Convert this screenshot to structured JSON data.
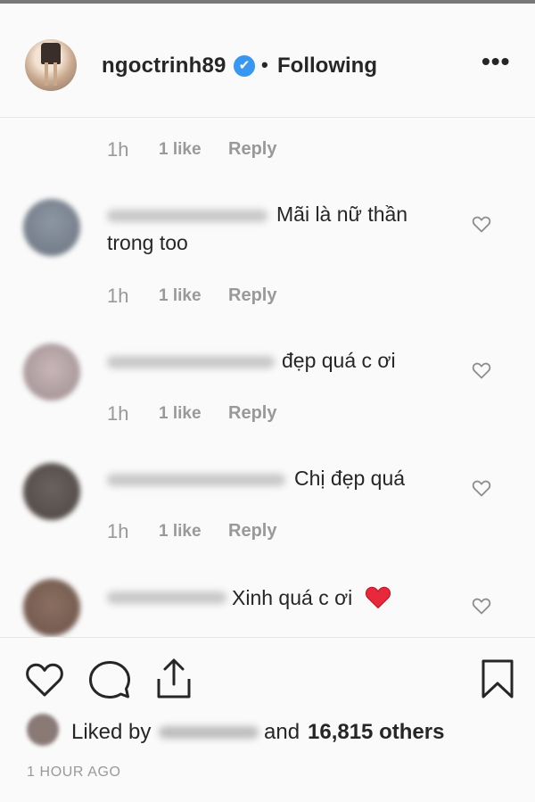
{
  "post": {
    "username": "ngoctrinh89",
    "verified_badge": "✔",
    "separator": "•",
    "follow_status": "Following",
    "more_label": "•••"
  },
  "comments": [
    {
      "text": "",
      "time": "1h",
      "likes": "1 like",
      "reply": "Reply"
    },
    {
      "text_line1": "Mãi là nữ thần",
      "text_line2": "trong too",
      "time": "1h",
      "likes": "1 like",
      "reply": "Reply"
    },
    {
      "text": "đẹp quá c ơi",
      "time": "1h",
      "likes": "1 like",
      "reply": "Reply"
    },
    {
      "text": "Chị đẹp quá",
      "time": "1h",
      "likes": "1 like",
      "reply": "Reply"
    },
    {
      "text": "Xinh quá c ơi",
      "emoji": "❤️"
    }
  ],
  "footer": {
    "liked_by_label": "Liked by",
    "and_label": "and",
    "others_label": "16,815 others",
    "timestamp": "1 HOUR AGO"
  },
  "icons": {
    "like": "heart-icon",
    "comment": "comment-icon",
    "share": "share-icon",
    "save": "bookmark-icon"
  },
  "colors": {
    "verified": "#3897f0",
    "heart_emoji": "#e8293b",
    "muted_text": "#999999"
  }
}
